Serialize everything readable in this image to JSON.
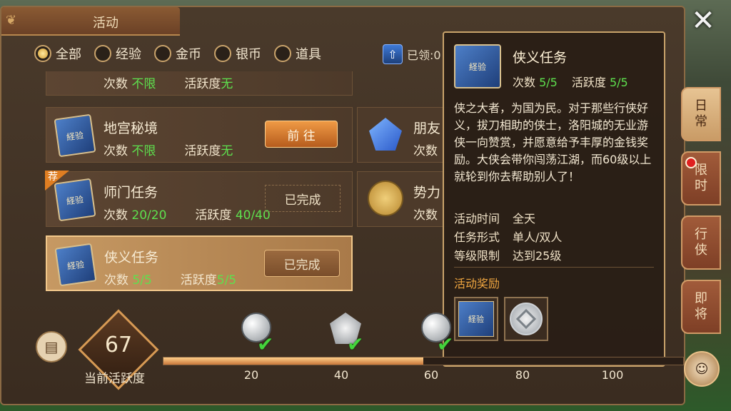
{
  "window": {
    "title": "活动"
  },
  "filters": [
    {
      "label": "全部",
      "selected": true
    },
    {
      "label": "经验",
      "selected": false
    },
    {
      "label": "金币",
      "selected": false
    },
    {
      "label": "银币",
      "selected": false
    },
    {
      "label": "道具",
      "selected": false
    }
  ],
  "claimed_label": "已领:0",
  "activities": [
    {
      "name": "",
      "count_label": "次数",
      "count_value": "不限",
      "activity_label": "活跃度",
      "activity_value": "无",
      "button": ""
    },
    {
      "name": "地宫秘境",
      "count_label": "次数",
      "count_value": "不限",
      "activity_label": "活跃度",
      "activity_value": "无",
      "button": "前 往",
      "icon_text": "経验"
    },
    {
      "name": "师门任务",
      "count_label": "次数",
      "count_value": "20/20",
      "activity_label": "活跃度",
      "activity_value": "40/40",
      "button": "已完成",
      "badge": "荐",
      "icon_text": "経验"
    },
    {
      "name": "侠义任务",
      "count_label": "次数",
      "count_value": "5/5",
      "activity_label": "活跃度",
      "activity_value": "5/5",
      "button": "已完成",
      "selected": true,
      "icon_text": "経验"
    }
  ],
  "right_activities": [
    {
      "name": "朋友",
      "count_label": "次数"
    },
    {
      "name": "势力",
      "count_label": "次数"
    }
  ],
  "tooltip": {
    "title": "侠义任务",
    "count_label": "次数",
    "count_value": "5/5",
    "activity_label": "活跃度",
    "activity_value": "5/5",
    "description": "侠之大者，为国为民。对于那些行侠好义，拔刀相助的侠士，洛阳城的无业游侠一向赞赏，并愿意给予丰厚的金钱奖励。大侠会带你闯荡江湖，而60级以上就轮到你去帮助别人了！",
    "time_label": "活动时间",
    "time_value": "全天",
    "form_label": "任务形式",
    "form_value": "单人/双人",
    "level_label": "等级限制",
    "level_value": "达到25级",
    "reward_label": "活动奖励",
    "icon_text": "経验"
  },
  "side_tabs": [
    {
      "label": "日常",
      "active": true
    },
    {
      "label": "限时",
      "active": false,
      "dot": true
    },
    {
      "label": "行侠",
      "active": false
    },
    {
      "label": "即将",
      "active": false
    }
  ],
  "activity": {
    "current_value": "67",
    "label": "当前活跃度",
    "progress_fraction": 0.5,
    "milestones": [
      "20",
      "40",
      "60",
      "80",
      "100"
    ]
  },
  "colors": {
    "accent": "#d79a54",
    "highlight_green": "#5ee04e",
    "reward_orange": "#f0a640"
  }
}
